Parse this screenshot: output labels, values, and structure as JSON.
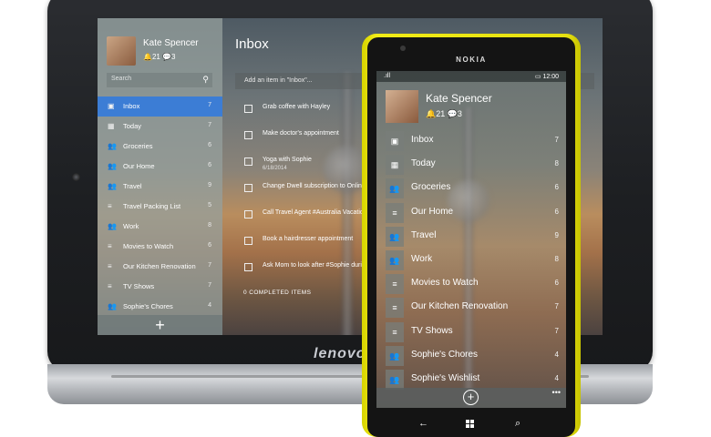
{
  "tablet": {
    "brand": "lenovo",
    "profile": {
      "name": "Kate Spencer",
      "stats": "🔔21  💬3"
    },
    "search": {
      "placeholder": "Search"
    },
    "lists": [
      {
        "label": "Inbox",
        "count": "7",
        "icon": "inbox-icon",
        "active": true
      },
      {
        "label": "Today",
        "count": "7",
        "icon": "calendar-icon",
        "active": false
      },
      {
        "label": "Groceries",
        "count": "6",
        "icon": "people-icon",
        "active": false
      },
      {
        "label": "Our Home",
        "count": "6",
        "icon": "people-icon",
        "active": false
      },
      {
        "label": "Travel",
        "count": "9",
        "icon": "people-icon",
        "active": false
      },
      {
        "label": "Travel Packing List",
        "count": "5",
        "icon": "list-icon",
        "active": false
      },
      {
        "label": "Work",
        "count": "8",
        "icon": "people-icon",
        "active": false
      },
      {
        "label": "Movies to Watch",
        "count": "6",
        "icon": "list-icon",
        "active": false
      },
      {
        "label": "Our Kitchen Renovation",
        "count": "7",
        "icon": "list-icon",
        "active": false
      },
      {
        "label": "TV Shows",
        "count": "7",
        "icon": "list-icon",
        "active": false
      },
      {
        "label": "Sophie's Chores",
        "count": "4",
        "icon": "people-icon",
        "active": false
      }
    ],
    "add_list": "+",
    "main": {
      "title": "Inbox",
      "add_placeholder": "Add an item in \"Inbox\"...",
      "tasks": [
        {
          "title": "Grab coffee with Hayley",
          "date": ""
        },
        {
          "title": "Make doctor's appointment",
          "date": ""
        },
        {
          "title": "Yoga with Sophie",
          "date": "6/18/2014"
        },
        {
          "title": "Change Dwell subscription to Online o",
          "date": ""
        },
        {
          "title": "Call Travel Agent #Australia Vacation",
          "date": ""
        },
        {
          "title": "Book a hairdresser appointment",
          "date": ""
        },
        {
          "title": "Ask Mom to look after #Sophie durin",
          "date": ""
        }
      ],
      "completed": "0 COMPLETED ITEMS"
    }
  },
  "phone": {
    "brand": "NOKIA",
    "status": {
      "signal": ".ıll",
      "time": "▭ 12:00"
    },
    "profile": {
      "name": "Kate Spencer",
      "stats": "🔔21  💬3"
    },
    "lists": [
      {
        "label": "Inbox",
        "count": "7",
        "icon": "inbox-icon"
      },
      {
        "label": "Today",
        "count": "8",
        "icon": "calendar-icon"
      },
      {
        "label": "Groceries",
        "count": "6",
        "icon": "people-icon"
      },
      {
        "label": "Our Home",
        "count": "6",
        "icon": "list-icon"
      },
      {
        "label": "Travel",
        "count": "9",
        "icon": "people-icon"
      },
      {
        "label": "Work",
        "count": "8",
        "icon": "people-icon"
      },
      {
        "label": "Movies to Watch",
        "count": "6",
        "icon": "list-icon"
      },
      {
        "label": "Our Kitchen Renovation",
        "count": "7",
        "icon": "list-icon"
      },
      {
        "label": "TV Shows",
        "count": "7",
        "icon": "list-icon"
      },
      {
        "label": "Sophie's Chores",
        "count": "4",
        "icon": "people-icon"
      },
      {
        "label": "Sophie's Wishlist",
        "count": "4",
        "icon": "people-icon"
      }
    ],
    "add": "+",
    "more": "•••",
    "nav": {
      "back": "←",
      "search": "⌕"
    }
  }
}
